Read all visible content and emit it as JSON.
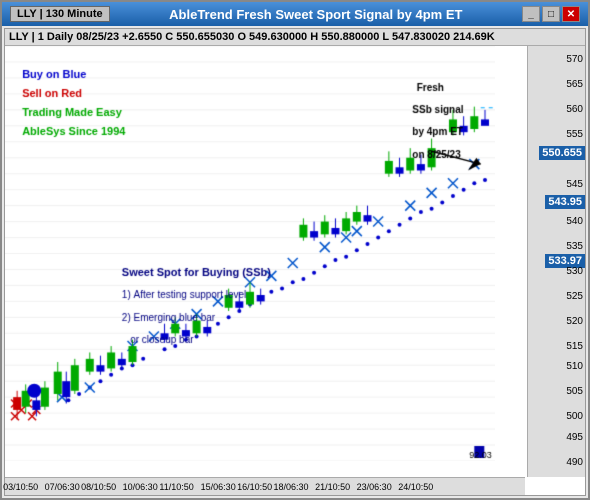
{
  "window": {
    "title": "AbleTrend Fresh Sweet Sport Signal by 4pm ET",
    "title_left": "LLY | 130 Minute"
  },
  "title_buttons": [
    "_",
    "□",
    "✕"
  ],
  "chart_header": "LLY | 1 Daily 08/25/23 +2.6550 C 550.655030 O 549.630000 H 550.880000 L 547.830020 214.69K",
  "price_labels": [
    {
      "value": "570",
      "y_pct": 2
    },
    {
      "value": "565",
      "y_pct": 8
    },
    {
      "value": "560",
      "y_pct": 14
    },
    {
      "value": "555",
      "y_pct": 20
    },
    {
      "value": "550.655",
      "y_pct": 24,
      "highlight": true
    },
    {
      "value": "545",
      "y_pct": 32
    },
    {
      "value": "543.95",
      "y_pct": 36,
      "highlight": true
    },
    {
      "value": "540",
      "y_pct": 41
    },
    {
      "value": "535",
      "y_pct": 47
    },
    {
      "value": "533.97",
      "y_pct": 50,
      "highlight": true
    },
    {
      "value": "530",
      "y_pct": 53
    },
    {
      "value": "525",
      "y_pct": 59
    },
    {
      "value": "520",
      "y_pct": 65
    },
    {
      "value": "515",
      "y_pct": 71
    },
    {
      "value": "510",
      "y_pct": 76
    },
    {
      "value": "505",
      "y_pct": 82
    },
    {
      "value": "500",
      "y_pct": 88
    },
    {
      "value": "495",
      "y_pct": 93
    },
    {
      "value": "490",
      "y_pct": 99
    }
  ],
  "time_labels": [
    {
      "label": "03/10:50",
      "x_pct": 3
    },
    {
      "label": "07/06:30",
      "x_pct": 11
    },
    {
      "label": "08/10:50",
      "x_pct": 18
    },
    {
      "label": "10/06:30",
      "x_pct": 26
    },
    {
      "label": "11/10:50",
      "x_pct": 33
    },
    {
      "label": "15/06:30",
      "x_pct": 41
    },
    {
      "label": "16/10:50",
      "x_pct": 48
    },
    {
      "label": "18/06:30",
      "x_pct": 55
    },
    {
      "label": "21/10:50",
      "x_pct": 63
    },
    {
      "label": "23/06:30",
      "x_pct": 71
    },
    {
      "label": "24/10:50",
      "x_pct": 79
    }
  ],
  "annotations": {
    "buy_on_blue": "Buy on Blue",
    "sell_on_red": "Sell on Red",
    "trading_made_easy": "Trading Made Easy",
    "ablesys": "AbleSys Since 1994",
    "sweet_spot_title": "Sweet Spot for Buying (SSb)",
    "sweet_spot_1": "1) After testing support level",
    "sweet_spot_2": "2) Emerging blue bar",
    "sweet_spot_3": "or closeup bar",
    "fresh_signal": "Fresh\nSSb signal\nby 4pm ET\non 8/25/23",
    "volume_label": "92.03"
  },
  "colors": {
    "blue_bar": "#0000cc",
    "green_bar": "#00aa00",
    "red_bar": "#cc0000",
    "dot_blue": "#0000cc",
    "dot_red": "#cc0000",
    "cross_blue": "#0000cc",
    "cross_green": "#00aa00",
    "background": "white",
    "grid": "#e0e0e0"
  }
}
